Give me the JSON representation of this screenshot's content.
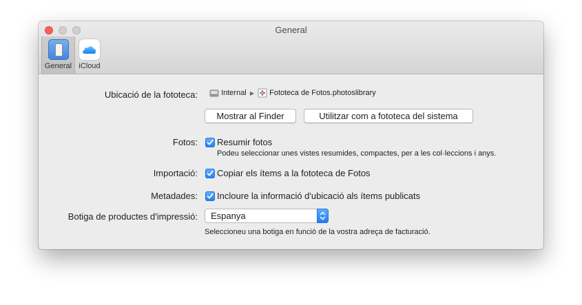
{
  "window": {
    "title": "General"
  },
  "toolbar": {
    "tabs": [
      {
        "label": "General",
        "icon": "general-icon",
        "selected": true
      },
      {
        "label": "iCloud",
        "icon": "icloud-icon",
        "selected": false
      }
    ]
  },
  "library": {
    "label": "Ubicació de la fototeca:",
    "path_volume": "Internal",
    "path_file": "Fototeca de Fotos.photoslibrary",
    "show_in_finder_button": "Mostrar al Finder",
    "use_as_system_library_button": "Utilitzar com a fototeca del sistema"
  },
  "photos": {
    "label": "Fotos:",
    "checkbox_label": "Resumir fotos",
    "checked": true,
    "note": "Podeu seleccionar unes vistes resumides, compactes, per a les col·leccions i anys."
  },
  "importing": {
    "label": "Importació:",
    "checkbox_label": "Copiar els ítems a la fototeca de Fotos",
    "checked": true
  },
  "metadata": {
    "label": "Metadades:",
    "checkbox_label": "Incloure la informació d'ubicació als ítems publicats",
    "checked": true
  },
  "print_store": {
    "label": "Botiga de productes d'impressió:",
    "selected_value": "Espanya",
    "note": "Seleccioneu una botiga en funció de la vostra adreça de facturació."
  },
  "colors": {
    "accent": "#1d7ef5",
    "close_button": "#fc605c",
    "window_background": "#ececec"
  }
}
